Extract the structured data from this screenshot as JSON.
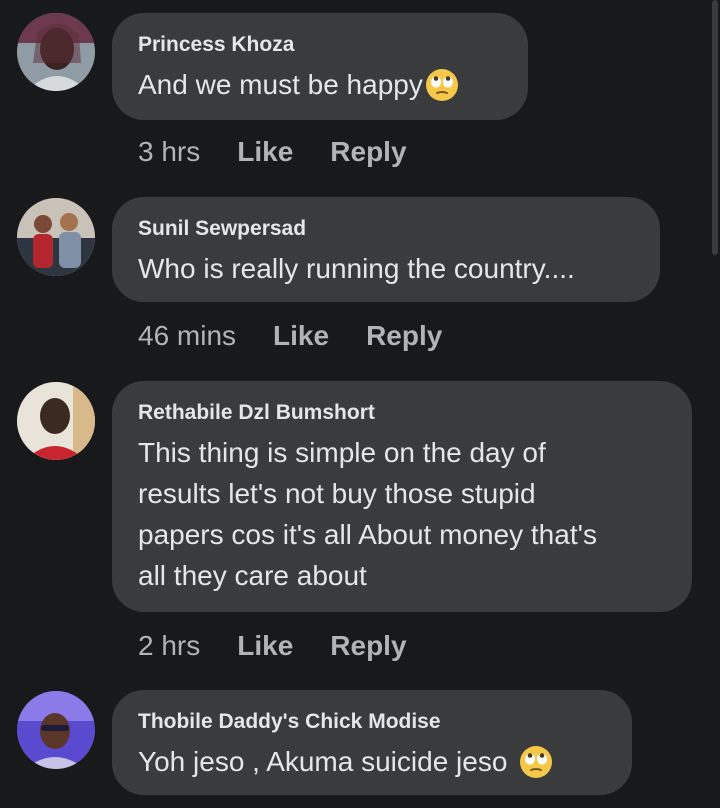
{
  "comments": [
    {
      "author": "Princess Khoza",
      "text": "And we must be happy",
      "emoji": "face-with-rolling-eyes",
      "time": "3 hrs",
      "like": "Like",
      "reply": "Reply"
    },
    {
      "author": "Sunil Sewpersad",
      "text": "Who is really running the country....",
      "time": "46 mins",
      "like": "Like",
      "reply": "Reply"
    },
    {
      "author": "Rethabile Dzl Bumshort",
      "text_lines": [
        "This thing is simple on the day of",
        "results let's not buy those stupid",
        "papers cos it's all About money that's",
        "all they care about"
      ],
      "time": "2 hrs",
      "like": "Like",
      "reply": "Reply"
    },
    {
      "author": "Thobile Daddy's Chick Modise",
      "text": "Yoh jeso , Akuma suicide jeso",
      "emoji": "face-with-rolling-eyes"
    }
  ],
  "colors": {
    "background": "#18191a",
    "bubble": "#3a3b3c",
    "primary_text": "#e4e6eb",
    "secondary_text": "#b0b3b8"
  }
}
